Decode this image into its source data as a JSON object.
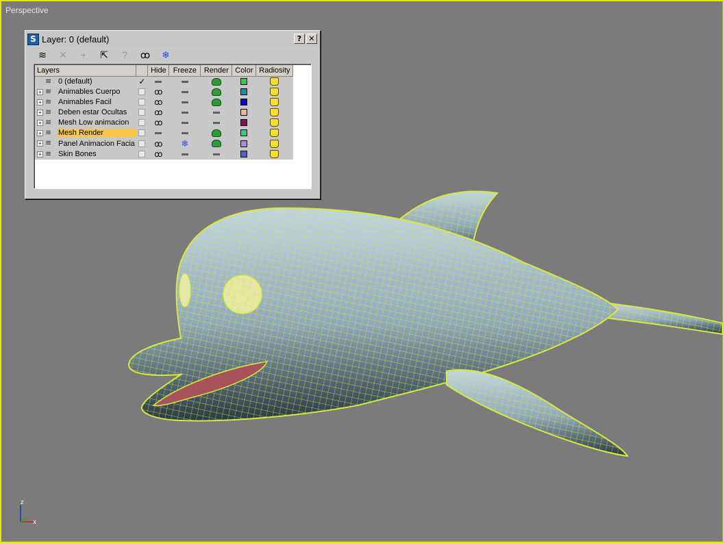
{
  "viewport": {
    "label": "Perspective"
  },
  "axis": {
    "z": "z",
    "x": "x"
  },
  "dialog": {
    "title": "Layer: 0 (default)",
    "help_btn": "?",
    "close_btn": "✕",
    "toolbar": [
      {
        "name": "new-layer-button",
        "icon": "new-layer-icon",
        "glyph": "≋",
        "enabled": true
      },
      {
        "name": "delete-layer-button",
        "icon": "delete-icon",
        "glyph": "✕",
        "enabled": false
      },
      {
        "name": "add-to-layer-button",
        "icon": "plus-icon",
        "glyph": "+",
        "enabled": false
      },
      {
        "name": "select-objects-button",
        "icon": "cursor-icon",
        "glyph": "⇱",
        "enabled": true
      },
      {
        "name": "highlight-selected-button",
        "icon": "question-icon",
        "glyph": "?",
        "enabled": false
      },
      {
        "name": "hide-all-button",
        "icon": "eye-icon",
        "glyph": "ꝏ",
        "enabled": true
      },
      {
        "name": "freeze-all-button",
        "icon": "snowflake-icon",
        "glyph": "❄",
        "enabled": true
      }
    ],
    "columns": [
      "Layers",
      "",
      "Hide",
      "Freeze",
      "Render",
      "Color",
      "Radiosity"
    ],
    "rows": [
      {
        "name": "0 (default)",
        "expandable": false,
        "active": true,
        "hide": "dash",
        "freeze": "dash",
        "render": "teapot",
        "color": "#2fcf4a",
        "selected": false
      },
      {
        "name": "Animables Cuerpo",
        "expandable": true,
        "active": false,
        "hide": "eye",
        "freeze": "dash",
        "render": "teapot",
        "color": "#1f8fa6",
        "selected": false
      },
      {
        "name": "Animables Facil",
        "expandable": true,
        "active": false,
        "hide": "eye",
        "freeze": "dash",
        "render": "teapot",
        "color": "#0a0ad8",
        "selected": false
      },
      {
        "name": "Deben estar Ocultas",
        "expandable": true,
        "active": false,
        "hide": "eye",
        "freeze": "dash",
        "render": "dash",
        "color": "#e7b79b",
        "selected": false
      },
      {
        "name": "Mesh Low animacion",
        "expandable": true,
        "active": false,
        "hide": "eye",
        "freeze": "dash",
        "render": "dash",
        "color": "#8a1453",
        "selected": false
      },
      {
        "name": "Mesh Render",
        "expandable": true,
        "active": false,
        "hide": "dash",
        "freeze": "dash",
        "render": "teapot",
        "color": "#36cc8e",
        "selected": true
      },
      {
        "name": "Panel Animacion Facia",
        "expandable": true,
        "active": false,
        "hide": "eye",
        "freeze": "snow",
        "render": "teapot",
        "color": "#a88fd8",
        "selected": false
      },
      {
        "name": "Skin Bones",
        "expandable": true,
        "active": false,
        "hide": "eye",
        "freeze": "dash",
        "render": "dash",
        "color": "#5a5ad4",
        "selected": false
      }
    ],
    "expand_glyph": "+",
    "tick_glyph": "✓",
    "eye_glyph": "ꝏ",
    "snow_glyph": "❄",
    "layer_glyph": "≋"
  },
  "colors": {
    "viewport_border": "#e7e700",
    "wire": "#d7ec3c",
    "skin": "#a9c3d2"
  }
}
